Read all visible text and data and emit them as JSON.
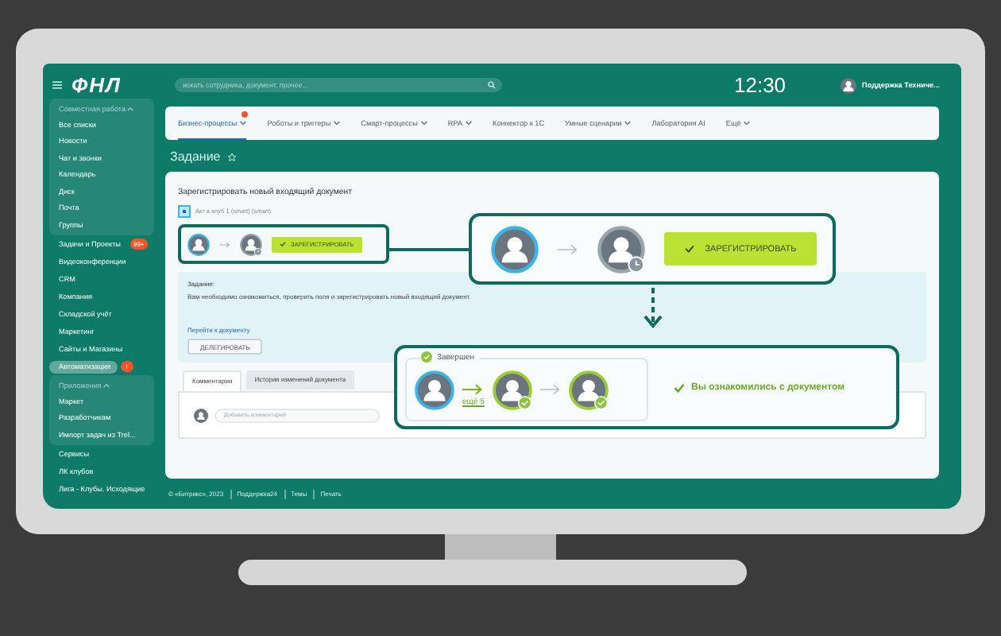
{
  "sidebar": {
    "logo": "ФНЛ",
    "entries": [
      {
        "kind": "section",
        "title": "Совместная работа",
        "expanded": true,
        "items": [
          {
            "label": "Все списки",
            "selected": false
          },
          {
            "label": "Новости",
            "selected": false
          },
          {
            "label": "Чат и звонки",
            "selected": false
          },
          {
            "label": "Календарь",
            "selected": false
          },
          {
            "label": "Диск",
            "selected": false
          },
          {
            "label": "Почта",
            "selected": false
          },
          {
            "label": "Группы",
            "selected": false
          }
        ]
      },
      {
        "kind": "item",
        "label": "Задачи и Проекты",
        "badge": "99+",
        "selected": false
      },
      {
        "kind": "item",
        "label": "Видеоконференции",
        "selected": false
      },
      {
        "kind": "item",
        "label": "CRM",
        "selected": false
      },
      {
        "kind": "item",
        "label": "Компания",
        "selected": false
      },
      {
        "kind": "item",
        "label": "Складской учёт",
        "selected": false
      },
      {
        "kind": "item",
        "label": "Маркетинг",
        "selected": false
      },
      {
        "kind": "item",
        "label": "Сайты и Магазины",
        "selected": false
      },
      {
        "kind": "item",
        "label": "Автоматизация",
        "badge": "!",
        "selected": true
      },
      {
        "kind": "section",
        "title": "Приложения",
        "expanded": true,
        "items": [
          {
            "label": "Маркет",
            "selected": false
          },
          {
            "label": "Разработчикам",
            "selected": false
          },
          {
            "label": "Импорт задач из Trel...",
            "selected": false
          }
        ]
      },
      {
        "kind": "item",
        "label": "Сервисы",
        "selected": false
      },
      {
        "kind": "item",
        "label": "ЛК клубов",
        "selected": false
      },
      {
        "kind": "item",
        "label": "Лига - Клубы. Исходящие",
        "selected": false
      }
    ]
  },
  "header": {
    "search": {
      "placeholder": "искать сотрудника, документ, прочее..."
    },
    "time": "12:30",
    "user": "Поддержка Техниче..."
  },
  "nav": {
    "tabs": [
      {
        "label": "Бизнес-процессы",
        "selected": true,
        "dropdown": true,
        "notified": true
      },
      {
        "label": "Роботы и триггеры",
        "selected": false,
        "dropdown": true,
        "notified": false
      },
      {
        "label": "Смарт-процессы",
        "selected": false,
        "dropdown": true,
        "notified": false
      },
      {
        "label": "RPA",
        "selected": false,
        "dropdown": true,
        "notified": false
      },
      {
        "label": "Коннектор к 1С",
        "selected": false,
        "dropdown": false,
        "notified": false
      },
      {
        "label": "Умные сценарии",
        "selected": false,
        "dropdown": true,
        "notified": false
      },
      {
        "label": "Лаборатория AI",
        "selected": false,
        "dropdown": false,
        "notified": false
      },
      {
        "label": "Ещё",
        "selected": false,
        "dropdown": true,
        "notified": false
      }
    ]
  },
  "page": {
    "title": "Задание"
  },
  "card": {
    "title": "Зарегистрировать новый входящий документ",
    "document": "Акт в клуб 1 (smart) (smart)",
    "flow": {
      "avatars": [
        {
          "kind": "current"
        },
        {
          "kind": "pending"
        }
      ],
      "button": "ЗАРЕГИСТРИРОВАТЬ"
    },
    "task": {
      "label": "Задание:",
      "text": "Вам необходимо ознакомиться, проверить поля и зарегистрировать новый входящий документ.",
      "link": "Перейти к документу",
      "button": "ДЕЛЕГИРОВАТЬ"
    },
    "tabs": [
      {
        "label": "Комментарии",
        "selected": true
      },
      {
        "label": "История изменений документа",
        "selected": false
      }
    ],
    "comment": {
      "placeholder": "Добавить комментарий"
    }
  },
  "callouts": {
    "action": {
      "avatars": [
        {
          "kind": "current"
        },
        {
          "kind": "pending"
        }
      ],
      "button": "ЗАРЕГИСТРИРОВАТЬ"
    },
    "result": {
      "status": "Завершен",
      "avatars": [
        {
          "kind": "current"
        },
        {
          "kind": "done"
        },
        {
          "kind": "done"
        }
      ],
      "more": "ещё 5",
      "message": "Вы ознакомились с документом"
    }
  },
  "footer": [
    "© «Битрикс», 2023",
    "Поддержка24",
    "Темы",
    "Печать"
  ]
}
